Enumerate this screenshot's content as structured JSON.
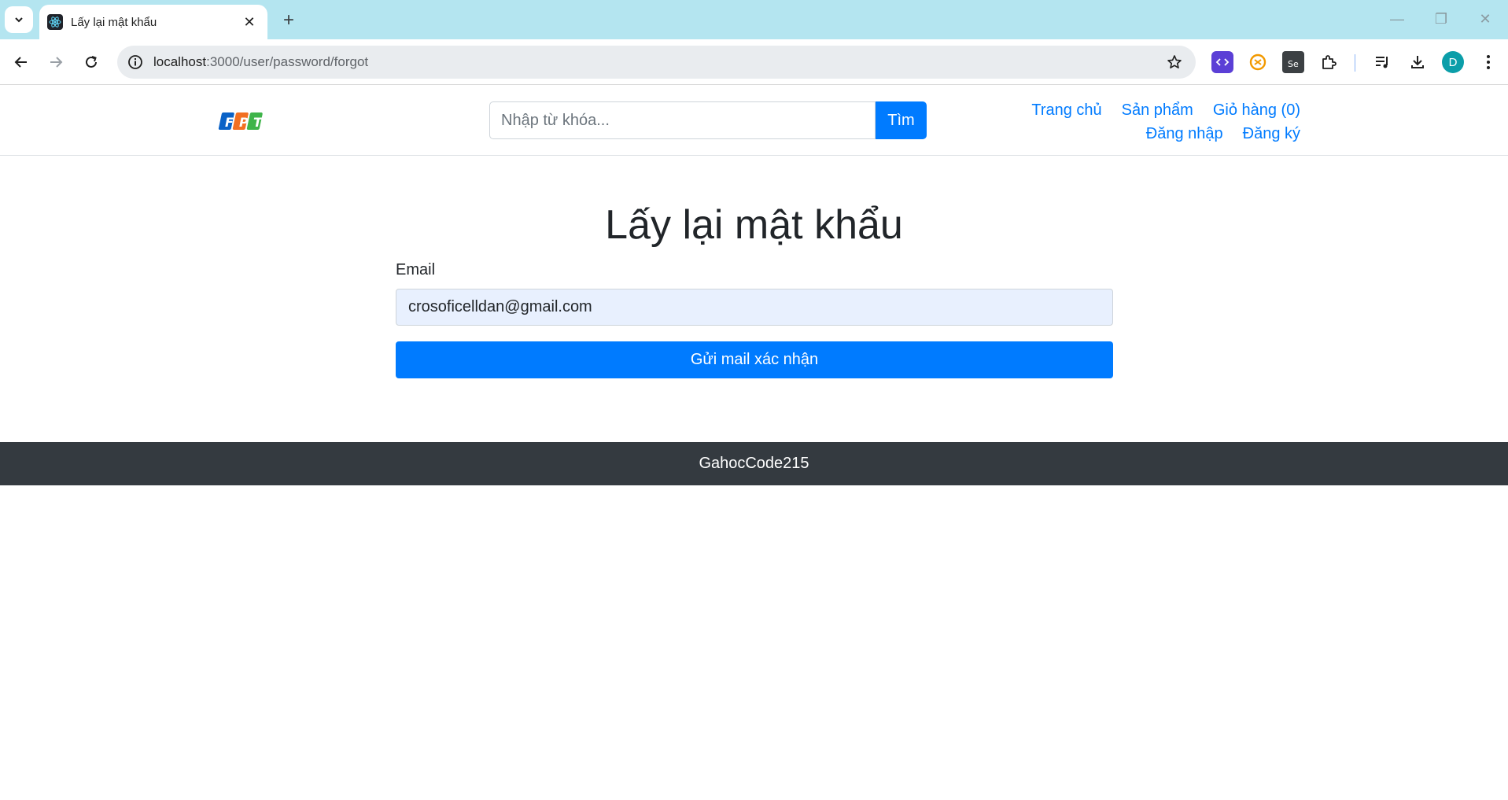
{
  "browser": {
    "tab": {
      "title": "Lấy lại mật khẩu",
      "close_glyph": "✕"
    },
    "new_tab_glyph": "+",
    "window": {
      "minimize_glyph": "—",
      "restore_glyph": "❐",
      "close_glyph": "✕"
    },
    "url": {
      "host": "localhost",
      "path": ":3000/user/password/forgot"
    },
    "profile_initial": "D"
  },
  "header": {
    "logo_letters": [
      "F",
      "P",
      "T"
    ],
    "search": {
      "placeholder": "Nhập từ khóa...",
      "button_label": "Tìm"
    },
    "nav": {
      "home": "Trang chủ",
      "products": "Sản phẩm",
      "cart": "Giỏ hàng (0)",
      "login": "Đăng nhập",
      "register": "Đăng ký"
    }
  },
  "main": {
    "title": "Lấy lại mật khẩu",
    "email_label": "Email",
    "email_value": "crosoficelldan@gmail.com",
    "submit_label": "Gửi mail xác nhận"
  },
  "footer": {
    "text": "GahocCode215"
  },
  "colors": {
    "primary": "#007bff",
    "footer_bg": "#343a40",
    "tabstrip_bg": "#b4e5f0",
    "autofill_bg": "#e8f0fe"
  }
}
